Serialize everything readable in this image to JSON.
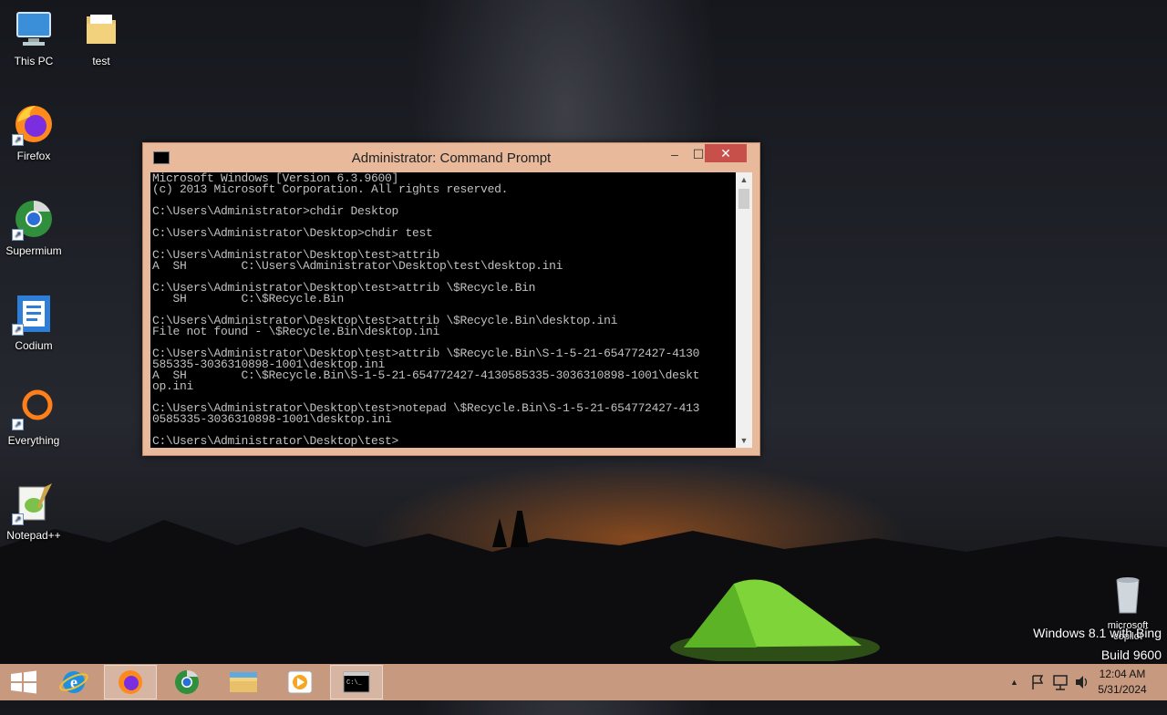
{
  "desktop": {
    "icons": [
      {
        "label": "This PC",
        "icon": "this-pc-icon"
      },
      {
        "label": "test",
        "icon": "folder-icon"
      },
      {
        "label": "Firefox",
        "icon": "firefox-icon"
      },
      {
        "label": "Supermium",
        "icon": "supermium-icon"
      },
      {
        "label": "Codium",
        "icon": "codium-icon"
      },
      {
        "label": "Everything",
        "icon": "everything-icon"
      },
      {
        "label": "Notepad++",
        "icon": "notepadpp-icon"
      }
    ],
    "recycle_bin_label": "microsoft copilot",
    "watermark_line1": "Windows 8.1 with Bing",
    "watermark_line2": "Build 9600"
  },
  "cmd_window": {
    "title": "Administrator: Command Prompt",
    "minimize": "–",
    "maximize": "☐",
    "close": "✕",
    "console_text": "Microsoft Windows [Version 6.3.9600]\n(c) 2013 Microsoft Corporation. All rights reserved.\n\nC:\\Users\\Administrator>chdir Desktop\n\nC:\\Users\\Administrator\\Desktop>chdir test\n\nC:\\Users\\Administrator\\Desktop\\test>attrib\nA  SH        C:\\Users\\Administrator\\Desktop\\test\\desktop.ini\n\nC:\\Users\\Administrator\\Desktop\\test>attrib \\$Recycle.Bin\n   SH        C:\\$Recycle.Bin\n\nC:\\Users\\Administrator\\Desktop\\test>attrib \\$Recycle.Bin\\desktop.ini\nFile not found - \\$Recycle.Bin\\desktop.ini\n\nC:\\Users\\Administrator\\Desktop\\test>attrib \\$Recycle.Bin\\S-1-5-21-654772427-4130\n585335-3036310898-1001\\desktop.ini\nA  SH        C:\\$Recycle.Bin\\S-1-5-21-654772427-4130585335-3036310898-1001\\deskt\nop.ini\n\nC:\\Users\\Administrator\\Desktop\\test>notepad \\$Recycle.Bin\\S-1-5-21-654772427-413\n0585335-3036310898-1001\\desktop.ini\n\nC:\\Users\\Administrator\\Desktop\\test>"
  },
  "taskbar": {
    "items": [
      {
        "name": "start-button",
        "icon": "windows-logo-icon",
        "active": false
      },
      {
        "name": "taskbar-internet-explorer",
        "icon": "ie-icon",
        "active": false
      },
      {
        "name": "taskbar-firefox",
        "icon": "firefox-icon",
        "active": true
      },
      {
        "name": "taskbar-supermium",
        "icon": "supermium-icon",
        "active": false
      },
      {
        "name": "taskbar-file-explorer",
        "icon": "file-explorer-icon",
        "active": false
      },
      {
        "name": "taskbar-media-player",
        "icon": "media-player-icon",
        "active": false
      },
      {
        "name": "taskbar-command-prompt",
        "icon": "cmd-icon",
        "active": true
      }
    ],
    "tray": {
      "chevron": "▲",
      "time": "12:04 AM",
      "date": "5/31/2024"
    }
  },
  "colors": {
    "taskbar": "#c79a80",
    "window_frame": "#e8b99a",
    "close_button": "#c7504b",
    "console_bg": "#000000",
    "console_text": "#c0c0c0"
  }
}
